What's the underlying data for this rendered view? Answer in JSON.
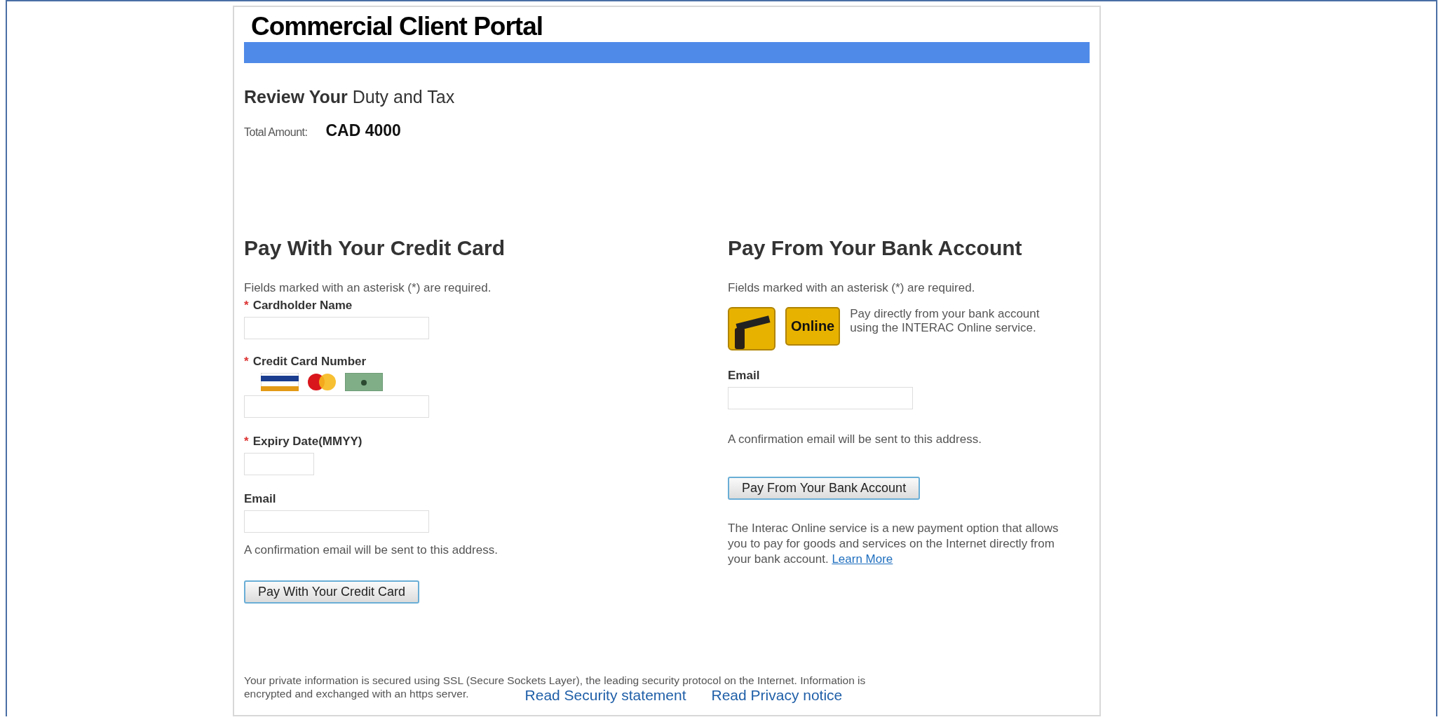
{
  "header": {
    "title": "Commercial Client Portal"
  },
  "review": {
    "title": "**Review Your** Duty and Tax",
    "total_label": "Total Amount:",
    "total_value": "CAD 4000"
  },
  "credit_card": {
    "title": "Pay With Your Credit Card",
    "note": "Fields marked with an asterisk (*) are required.",
    "fields": [
      {
        "kind": "wide",
        "mark": "*",
        "label": "Cardholder Name"
      },
      {
        "kind": "card",
        "mark": "*",
        "label": "Credit Card Number"
      },
      {
        "kind": "short",
        "mark": "*",
        "label": "Expiry Date(MMYY)"
      },
      {
        "kind": "wide",
        "label": "Email"
      }
    ],
    "confirmation": "A confirmation email will be sent to this address.",
    "button": "Pay With Your Credit Card"
  },
  "bank": {
    "title": "Pay From Your Bank Account",
    "note": "Fields marked with an asterisk (*) are required.",
    "logo_text": "Online",
    "description": "Pay directly from your bank account using the INTERAC Online service.",
    "email_label": "Email",
    "confirmation": "A confirmation email will be sent to this address.",
    "button": "Pay From Your Bank Account",
    "info": "The Interac Online service is a new payment option that allows you to pay for goods and services on the Internet directly from your bank account.",
    "learn_more": "Learn More"
  },
  "footer": {
    "notice_lines": [
      "Your private information is secured using SSL (Secure Sockets Layer), the leading security protocol on the Internet. Information is",
      "encrypted and exchanged with an https server."
    ],
    "links": [
      "Read Security statement",
      "Read Privacy notice"
    ]
  }
}
